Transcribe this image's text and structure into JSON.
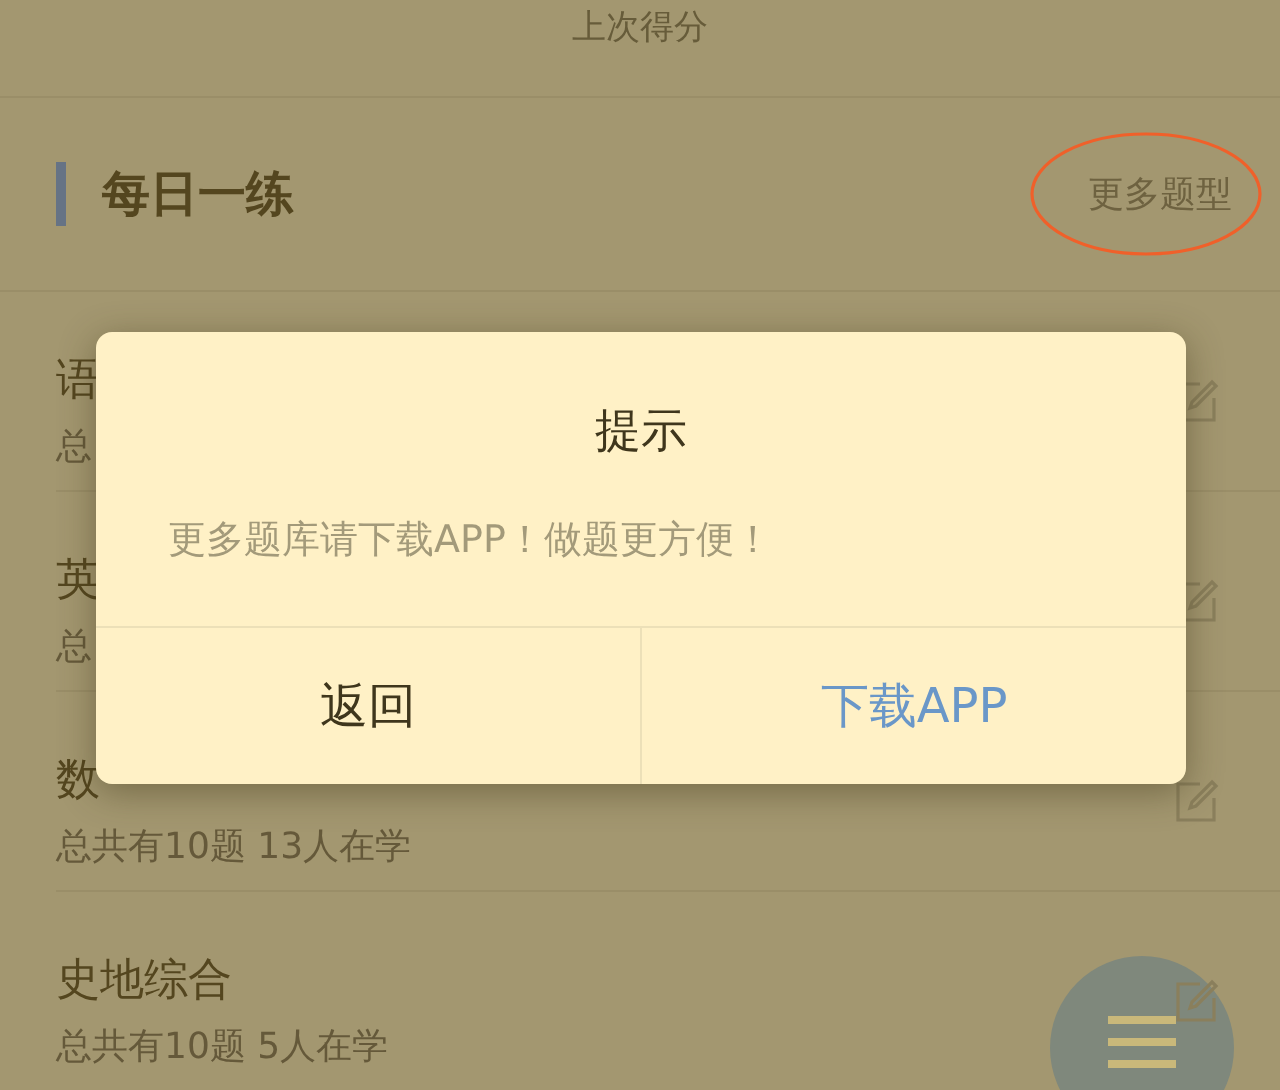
{
  "top_label": "上次得分",
  "section": {
    "title": "每日一练",
    "more_button": {
      "label": "更多题型",
      "highlighted": true
    }
  },
  "subjects": [
    {
      "title": "语",
      "subtitle": "总"
    },
    {
      "title": "英",
      "subtitle": "总"
    },
    {
      "title": "数",
      "subtitle": "总共有10题 13人在学"
    },
    {
      "title": "史地综合",
      "subtitle": "总共有10题 5人在学"
    }
  ],
  "dialog": {
    "title": "提示",
    "message": "更多题库请下载APP！做题更方便！",
    "buttons": [
      {
        "label": "返回",
        "kind": "cancel"
      },
      {
        "label": "下载APP",
        "kind": "confirm"
      }
    ]
  }
}
